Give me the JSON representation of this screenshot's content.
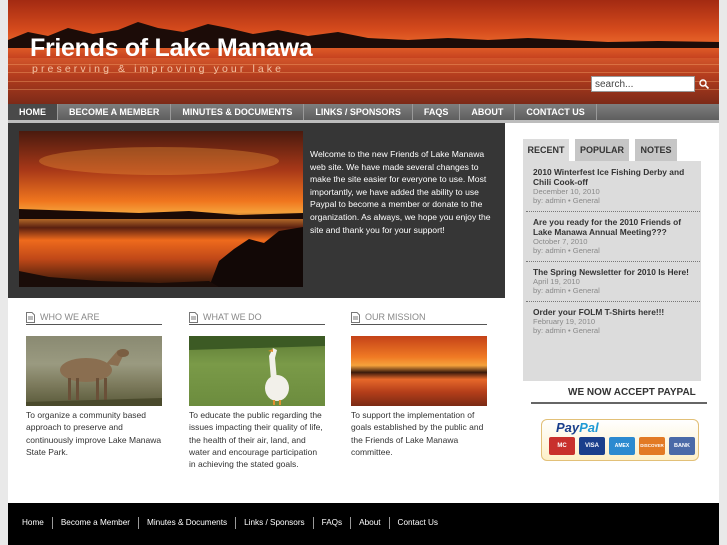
{
  "header": {
    "site_title": "Friends of Lake Manawa",
    "tagline": "preserving & improving your lake",
    "search_value": "search..."
  },
  "nav": {
    "items": [
      {
        "label": "HOME",
        "active": true
      },
      {
        "label": "BECOME A MEMBER",
        "active": false
      },
      {
        "label": "MINUTES & DOCUMENTS",
        "active": false
      },
      {
        "label": "LINKS / SPONSORS",
        "active": false
      },
      {
        "label": "FAQS",
        "active": false
      },
      {
        "label": "ABOUT",
        "active": false
      },
      {
        "label": "CONTACT US",
        "active": false
      }
    ]
  },
  "feature": {
    "text": "Welcome to the new Friends of Lake Manawa web site. We have made several changes to make the site easier for everyone to use. Most importantly, we have added the ability to use Paypal to become a member or donate to the organization. As always, we hope you enjoy the site and thank you for your support!"
  },
  "columns": [
    {
      "heading": "WHO WE ARE",
      "text": "To organize a community based approach to preserve and continuously improve Lake Manawa State Park."
    },
    {
      "heading": "WHAT WE DO",
      "text": "To educate the public regarding the issues impacting their quality of life, the health of their air, land, and water and encourage participation in achieving the stated goals."
    },
    {
      "heading": "OUR MISSION",
      "text": "To support the implementation of goals established by the public and the Friends of Lake Manawa committee."
    }
  ],
  "sidebar": {
    "tabs": [
      {
        "label": "RECENT",
        "active": true
      },
      {
        "label": "POPULAR",
        "active": false
      },
      {
        "label": "NOTES",
        "active": false
      }
    ],
    "posts": [
      {
        "title": "2010 Winterfest Ice Fishing Derby and Chili Cook-off",
        "date": "December 10, 2010",
        "meta": "by: admin • General"
      },
      {
        "title": "Are you ready for the 2010 Friends of Lake Manawa Annual Meeting???",
        "date": "October 7, 2010",
        "meta": "by: admin • General"
      },
      {
        "title": "The Spring Newsletter for 2010 Is Here!",
        "date": "April 19, 2010",
        "meta": "by: admin • General"
      },
      {
        "title": "Order your FOLM T-Shirts here!!!",
        "date": "February 19, 2010",
        "meta": "by: admin • General"
      }
    ],
    "paypal_heading": "WE NOW ACCEPT PAYPAL",
    "paypal_logo_pay": "Pay",
    "paypal_logo_pal": "Pal",
    "cards": [
      {
        "label": "MC",
        "color": "#c8302c"
      },
      {
        "label": "VISA",
        "color": "#1a3f8c"
      },
      {
        "label": "AMEX",
        "color": "#2c8ad0"
      },
      {
        "label": "DISCOVER",
        "color": "#e27a24"
      },
      {
        "label": "BANK",
        "color": "#4a6aa8"
      }
    ]
  },
  "footer": {
    "links": [
      "Home",
      "Become a Member",
      "Minutes & Documents",
      "Links / Sponsors",
      "FAQs",
      "About",
      "Contact Us"
    ]
  },
  "colors": {
    "nav_bg": "#6e6e6e",
    "feature_bg": "#363636",
    "footer_bg": "#000000",
    "sidebar_box": "#dcdcdc"
  }
}
